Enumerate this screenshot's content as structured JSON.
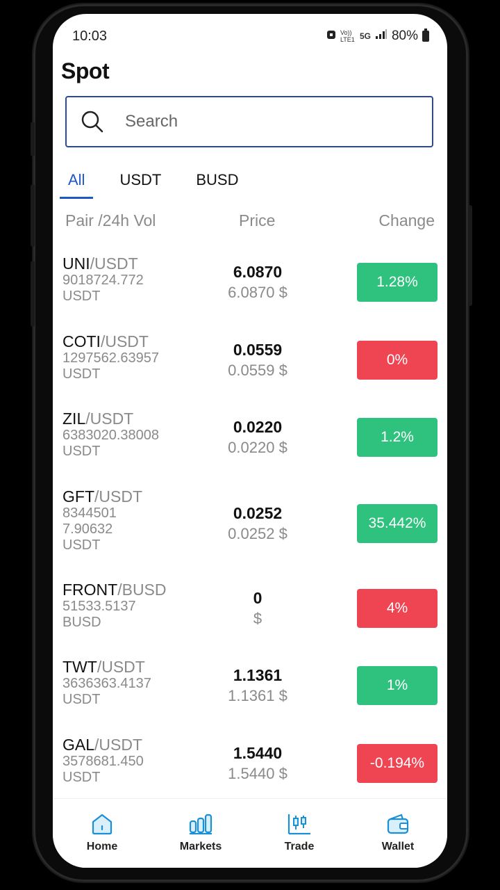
{
  "status_bar": {
    "time": "10:03",
    "network_volte": "Vo)) LTE1",
    "network_5g": "5G",
    "battery": "80%"
  },
  "page": {
    "title": "Spot"
  },
  "search": {
    "placeholder": "Search"
  },
  "tabs": [
    {
      "label": "All",
      "active": true
    },
    {
      "label": "USDT",
      "active": false
    },
    {
      "label": "BUSD",
      "active": false
    }
  ],
  "columns": {
    "pair": "Pair /24h Vol",
    "price": "Price",
    "change": "Change"
  },
  "rows": [
    {
      "base": "UNI",
      "quote": "/USDT",
      "vol": "9018724.772",
      "vol_unit": "USDT",
      "price": "6.0870",
      "price_usd": "6.0870 $",
      "change": "1.28%",
      "trend": "up"
    },
    {
      "base": "COTI",
      "quote": "/USDT",
      "vol": "1297562.63957",
      "vol_unit": "USDT",
      "price": "0.0559",
      "price_usd": "0.0559 $",
      "change": "0%",
      "trend": "down"
    },
    {
      "base": "ZIL",
      "quote": "/USDT",
      "vol": "6383020.38008",
      "vol_unit": "USDT",
      "price": "0.0220",
      "price_usd": "0.0220 $",
      "change": "1.2%",
      "trend": "up"
    },
    {
      "base": "GFT",
      "quote": "/USDT",
      "vol": "83445017.90632",
      "vol_unit": "USDT",
      "price": "0.0252",
      "price_usd": "0.0252 $",
      "change": "35.442%",
      "trend": "up"
    },
    {
      "base": "FRONT",
      "quote": "/BUSD",
      "vol": "51533.5137",
      "vol_unit": "BUSD",
      "price": "0",
      "price_usd": "$",
      "change": "4%",
      "trend": "down"
    },
    {
      "base": "TWT",
      "quote": "/USDT",
      "vol": "3636363.4137",
      "vol_unit": "USDT",
      "price": "1.1361",
      "price_usd": "1.1361 $",
      "change": "1%",
      "trend": "up"
    },
    {
      "base": "GAL",
      "quote": "/USDT",
      "vol": "3578681.450",
      "vol_unit": "USDT",
      "price": "1.5440",
      "price_usd": "1.5440 $",
      "change": "-0.194%",
      "trend": "down"
    }
  ],
  "nav": [
    {
      "label": "Home",
      "icon": "home-icon"
    },
    {
      "label": "Markets",
      "icon": "markets-icon"
    },
    {
      "label": "Trade",
      "icon": "trade-icon"
    },
    {
      "label": "Wallet",
      "icon": "wallet-icon"
    }
  ],
  "colors": {
    "accent": "#1e57c7",
    "up": "#2ec27e",
    "down": "#ef4452",
    "nav_icon": "#1a8fd6"
  }
}
